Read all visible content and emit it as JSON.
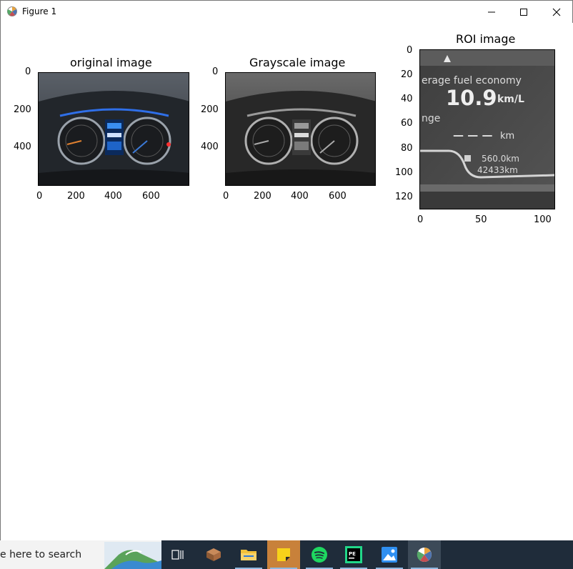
{
  "window": {
    "title": "Figure 1",
    "minimize_glyph": "—",
    "maximize_glyph": "☐",
    "close_glyph": "✕"
  },
  "axes": [
    {
      "title": "original image",
      "x_ticks": [
        "0",
        "200",
        "400",
        "600"
      ],
      "y_ticks": [
        "0",
        "200",
        "400"
      ]
    },
    {
      "title": "Grayscale image",
      "x_ticks": [
        "0",
        "200",
        "400",
        "600"
      ],
      "y_ticks": [
        "0",
        "200",
        "400"
      ]
    },
    {
      "title": "ROI image",
      "x_ticks": [
        "0",
        "50",
        "100"
      ],
      "y_ticks": [
        "0",
        "20",
        "40",
        "60",
        "80",
        "100",
        "120"
      ],
      "roi_text": {
        "line1": "erage fuel economy",
        "value": "10.9",
        "unit": "km/L",
        "line3": "nge",
        "dashes": "— — —",
        "km": "km",
        "range_value": "560.0km",
        "odometer": "42433km"
      }
    }
  ],
  "taskbar": {
    "search_text": "e here to search",
    "items": [
      "task-view",
      "app",
      "file-explorer",
      "sticky-notes",
      "spotify",
      "pycharm",
      "photos",
      "matplotlib"
    ]
  }
}
